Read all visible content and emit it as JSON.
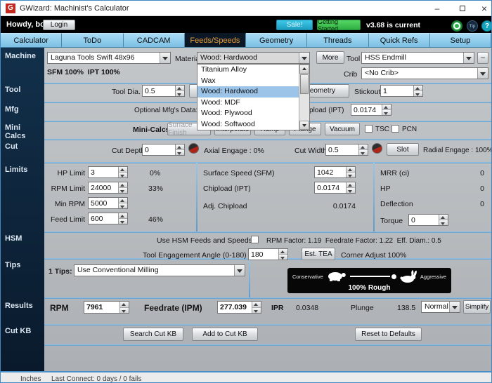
{
  "window": {
    "title": "GWizard: Machinist's Calculator",
    "app_initial": "G",
    "minimize_glyph": "–",
    "close_glyph": "×"
  },
  "toolbar": {
    "greeting": "Howdy, bob!",
    "login": "Login",
    "sale": "Sale!",
    "getting_started": "Getting Started",
    "version": "v3.68 is current",
    "tip_glyph": "Tip",
    "help_glyph": "?"
  },
  "tabs": {
    "items": [
      "Calculator",
      "ToDo",
      "CADCAM",
      "Feeds/Speeds",
      "Geometry",
      "Threads",
      "Quick Refs",
      "Setup"
    ],
    "active": "Feeds/Speeds"
  },
  "sidebar": {
    "sections": [
      "Machine",
      "Tool",
      "Mfg",
      "Mini Calcs",
      "Cut",
      "Limits",
      "HSM",
      "Tips",
      "Results",
      "Cut KB"
    ]
  },
  "machine": {
    "machine_select": "Laguna Tools Swift 48x96",
    "material_label": "Material",
    "material_select": "Wood: Hardwood",
    "material_options": [
      "Titanium Alloy",
      "Wax",
      "Wood: Hardwood",
      "Wood: MDF",
      "Wood: Plywood",
      "Wood: Softwood"
    ],
    "more": "More",
    "tool_label": "Tool",
    "tool_select": "HSS Endmill",
    "tool_more": "–",
    "crib_label": "Crib",
    "crib_select": "<No Crib>",
    "sfm_text": "SFM 100%  IPT 100%"
  },
  "tool": {
    "dia_label": "Tool Dia.",
    "dia_value": "0.5",
    "geometry": "Geometry",
    "stickout_label": "Stickout",
    "stickout_value": "1"
  },
  "mfg": {
    "optional_label": "Optional Mfg's Data:  Surface Speed (SFM)",
    "chipload_label": "Chipload (IPT)",
    "chipload_value": "0.0174"
  },
  "minicalcs": {
    "label": "Mini-Calcs",
    "surface_finish": "Surface Finish",
    "interpolate": "Interpolate",
    "ramp": "Ramp",
    "plunge": "Plunge",
    "vacuum": "Vacuum",
    "tsc": "TSC",
    "pcn": "PCN"
  },
  "cut": {
    "depth_label": "Cut Depth",
    "depth_value": "0",
    "axial_text": "Axial Engage : 0%",
    "width_label": "Cut Width",
    "width_value": "0.5",
    "slot": "Slot",
    "radial_text": "Radial Engage : 100%"
  },
  "limits": {
    "rows": [
      {
        "label": "HP Limit",
        "value": "3",
        "pct": "0%"
      },
      {
        "label": "RPM Limit",
        "value": "24000",
        "pct": "33%"
      },
      {
        "label": "Min RPM",
        "value": "5000",
        "pct": ""
      },
      {
        "label": "Feed Limit",
        "value": "600",
        "pct": "46%"
      }
    ],
    "surface_label": "Surface Speed (SFM)",
    "surface_value": "1042",
    "chipload_label": "Chipload (IPT)",
    "chipload_value": "0.0174",
    "adj_label": "Adj. Chipload",
    "adj_value": "0.0174",
    "mrr_label": "MRR (ci)",
    "mrr_value": "0",
    "hp_label": "HP",
    "hp_value": "0",
    "deflection_label": "Deflection",
    "deflection_value": "0",
    "torque_label": "Torque",
    "torque_value": "0"
  },
  "hsm": {
    "use_label": "Use HSM Feeds and Speeds",
    "factors": "RPM Factor: 1.19  Feedrate Factor: 1.22  Eff. Diam.: 0.5",
    "tea_label": "Tool Engagement Angle (0-180)",
    "tea_value": "180",
    "est_tea": "Est. TEA",
    "corner_text": "Corner Adjust 100%"
  },
  "tips": {
    "label": "1 Tips:",
    "select": "Use Conventional Milling",
    "conservative": "Conservative",
    "aggressive": "Aggressive",
    "rough_text": "100% Rough"
  },
  "results": {
    "rpm_label": "RPM",
    "rpm_value": "7961",
    "feedrate_label": "Feedrate (IPM)",
    "feedrate_value": "277.039",
    "ipr_label": "IPR",
    "ipr_value": "0.0348",
    "plunge_label": "Plunge",
    "plunge_value": "138.5",
    "mode_select": "Normal",
    "simplify": "Simplify"
  },
  "cutkb": {
    "search": "Search Cut KB",
    "add": "Add to Cut KB",
    "reset": "Reset to Defaults"
  },
  "statusbar": {
    "units": "Inches",
    "connect": "Last Connect: 0 days / 0 fails"
  },
  "colors": {
    "sidebar_bg": "#0b1d30",
    "tab_blue": "#8ccdec",
    "active_tab_bg": "#0c1725",
    "active_tab_text": "#e9a13b",
    "divider_blue": "#6fa9d6",
    "sale_cyan": "#29b7d9",
    "getting_started_green": "#3fc050",
    "selection_blue": "#9cc3e8"
  }
}
